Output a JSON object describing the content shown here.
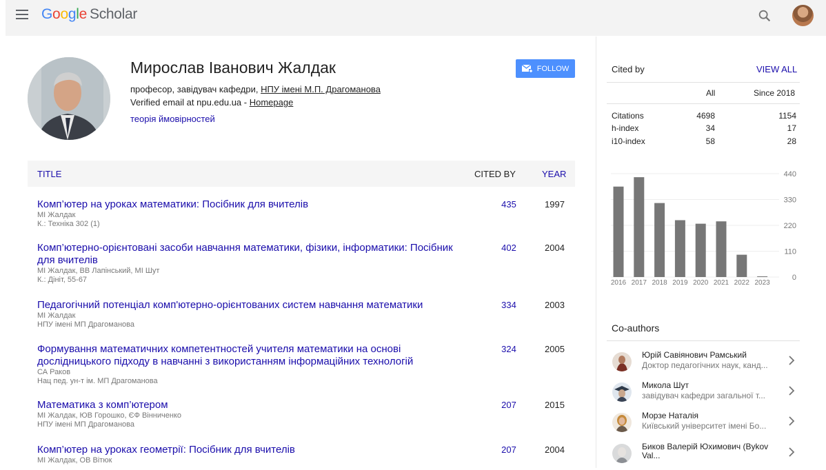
{
  "header": {
    "logo_google": [
      "G",
      "o",
      "o",
      "g",
      "l",
      "e"
    ],
    "logo_scholar": "Scholar"
  },
  "profile": {
    "name": "Мирослав Іванович Жалдак",
    "affiliation_prefix": "професор, завідувач кафедри, ",
    "affiliation_link": "НПУ імені М.П. Драгоманова",
    "email_text": "Verified email at npu.edu.ua - ",
    "homepage": "Homepage",
    "interest": "теорія ймовірностей",
    "follow_label": "FOLLOW"
  },
  "table": {
    "col_title": "TITLE",
    "col_cited": "CITED BY",
    "col_year": "YEAR",
    "rows": [
      {
        "title": "Комп’ютер на уроках математики: Посібник для вчителів",
        "authors": "МІ Жалдак",
        "venue": "К.: Техніка 302 (1)",
        "cites": "435",
        "year": "1997"
      },
      {
        "title": "Комп’ютерно-орієнтовані засоби навчання математики, фізики, інформатики: Посібник для вчителів",
        "authors": "МІ Жалдак, ВВ Лапінський, МІ Шут",
        "venue": "К.: Дініт, 55-67",
        "cites": "402",
        "year": "2004"
      },
      {
        "title": "Педагогічний потенціал комп'ютерно-орієнтованих систем навчання математики",
        "authors": "МІ Жалдак",
        "venue": "НПУ імені МП Драгоманова",
        "cites": "334",
        "year": "2003"
      },
      {
        "title": "Формування математичних компетентностей учителя математики на основі дослідницького підходу в навчанні з використанням інформаційних технологій",
        "authors": "СА Раков",
        "venue": "Нац пед. ун-т ім. МП Драгоманова",
        "cites": "324",
        "year": "2005"
      },
      {
        "title": "Математика з комп’ютером",
        "authors": "МІ Жалдак, ЮВ Горошко, ЄФ Вінниченко",
        "venue": "НПУ імені МП Драгоманова",
        "cites": "207",
        "year": "2015"
      },
      {
        "title": "Комп’ютер на уроках геометрії: Посібник для вчителів",
        "authors": "МІ Жалдак, ОВ Вітюк",
        "venue": "",
        "cites": "207",
        "year": "2004"
      }
    ]
  },
  "cited_by": {
    "label": "Cited by",
    "view_all": "VIEW ALL",
    "col_all": "All",
    "col_since": "Since 2018",
    "stats": [
      {
        "label": "Citations",
        "all": "4698",
        "since": "1154"
      },
      {
        "label": "h-index",
        "all": "34",
        "since": "17"
      },
      {
        "label": "i10-index",
        "all": "58",
        "since": "28"
      }
    ]
  },
  "chart_data": {
    "type": "bar",
    "categories": [
      "2016",
      "2017",
      "2018",
      "2019",
      "2020",
      "2021",
      "2022",
      "2023"
    ],
    "values": [
      385,
      425,
      315,
      242,
      227,
      237,
      95,
      3
    ],
    "y_ticks": [
      "440",
      "330",
      "220",
      "110",
      "0"
    ],
    "ylim": [
      0,
      440
    ],
    "bar_color": "#777777"
  },
  "coauthors": {
    "label": "Co-authors",
    "items": [
      {
        "name": "Юрій Савіянович Рамський",
        "desc": "Доктор педагогічних наук, канд..."
      },
      {
        "name": "Микола Шут",
        "desc": "завідувач кафедри загальної т..."
      },
      {
        "name": "Морзе Наталія",
        "desc": "Київський університет імені Бо..."
      },
      {
        "name": "Биков Валерій Юхимович (Bykov Val...",
        "desc": ""
      }
    ]
  }
}
